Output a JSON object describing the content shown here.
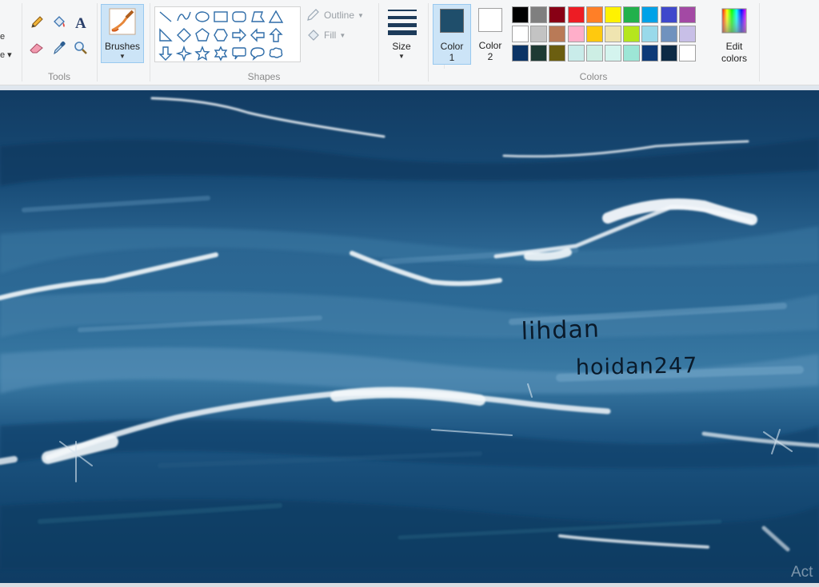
{
  "ribbon": {
    "partial_text_1": "e",
    "partial_text_2": "e",
    "groups": {
      "tools": "Tools",
      "shapes": "Shapes",
      "colors": "Colors"
    },
    "brushes_label": "Brushes",
    "outline_label": "Outline",
    "fill_label": "Fill",
    "size_label": "Size",
    "color1": {
      "line1": "Color",
      "line2": "1",
      "value": "#1f4e6b"
    },
    "color2": {
      "line1": "Color",
      "line2": "2",
      "value": "#ffffff"
    },
    "edit_colors": {
      "line1": "Edit",
      "line2": "colors"
    }
  },
  "palette": [
    [
      "#000000",
      "#7f7f7f",
      "#880015",
      "#ed1c24",
      "#ff7f27",
      "#fff200",
      "#22b14c",
      "#00a2e8",
      "#3f48cc",
      "#a349a4"
    ],
    [
      "#ffffff",
      "#c3c3c3",
      "#b97a57",
      "#ffaec9",
      "#ffc90e",
      "#efe4b0",
      "#b5e61d",
      "#99d9ea",
      "#7092be",
      "#c8bfe7"
    ],
    [
      "#0b3466",
      "#1e3a34",
      "#6b5e10",
      "#c9ecea",
      "#cdeee4",
      "#d4f4ee",
      "#9de6d6",
      "#0d3a78",
      "#0c2a45",
      "#ffffff"
    ]
  ],
  "canvas": {
    "signature_1": "lihdan",
    "signature_2": "hoidan247"
  },
  "watermark": "Act"
}
